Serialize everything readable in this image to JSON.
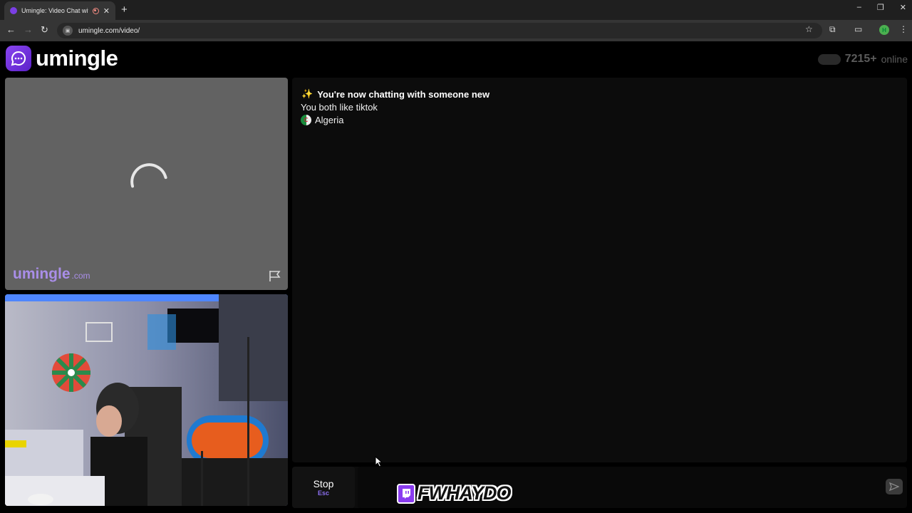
{
  "browser": {
    "tab_title": "Umingle: Video Chat with S",
    "url": "umingle.com/video/",
    "new_tab_label": "+",
    "window_controls": [
      "–",
      "❐",
      "✕"
    ],
    "profile_initial": "H"
  },
  "header": {
    "logo_text": "umingle",
    "online_count": "7215+",
    "online_label": "online"
  },
  "stranger_video": {
    "watermark_main": "umingle",
    "watermark_suffix": ".com",
    "state": "loading"
  },
  "chat": {
    "messages": [
      {
        "icon": "sparkles-icon",
        "text": "You're now chatting with someone new"
      },
      {
        "text": "You both like tiktok"
      },
      {
        "icon": "algeria-flag-icon",
        "text": "Algeria"
      }
    ]
  },
  "controls": {
    "stop_label": "Stop",
    "stop_shortcut": "Esc",
    "chat_input_value": ""
  },
  "stream_overlay": {
    "name": "FWHAYDO",
    "icon": "twitch-icon"
  },
  "colors": {
    "brand": "#7b3fe4",
    "watermark": "#a98ee8",
    "shortcut": "#8c6ff0"
  }
}
